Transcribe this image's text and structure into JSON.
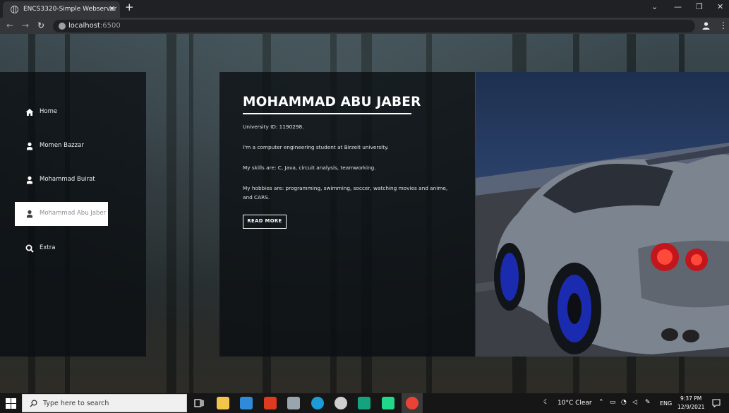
{
  "browser": {
    "tab_title": "ENCS3320-Simple Webserver",
    "tab_close": "✕",
    "new_tab": "+",
    "url_host": "localhost",
    "url_port": ":6500",
    "window_controls": {
      "minimize": "—",
      "maximize": "❐",
      "close": "✕",
      "tab_search": "⌄"
    },
    "nav": {
      "back": "←",
      "forward": "→",
      "reload": "↻"
    }
  },
  "sidebar": {
    "items": [
      {
        "label": "Home",
        "icon": "home-icon",
        "active": false
      },
      {
        "label": "Momen Bazzar",
        "icon": "user-icon",
        "active": false
      },
      {
        "label": "Mohammad Buirat",
        "icon": "user-icon",
        "active": false
      },
      {
        "label": "Mohammad Abu Jaber",
        "icon": "user-icon",
        "active": true
      },
      {
        "label": "Extra",
        "icon": "search-icon",
        "active": false
      }
    ]
  },
  "profile": {
    "name": "MOHAMMAD ABU JABER",
    "university_id": "University ID: 1190298.",
    "about": "I'm a computer engineering student at Birzeit university.",
    "skills": "My skills are: C, Java, circuit analysis, teamworking.",
    "hobbies": "My hobbies are: programming, swimming, soccer, watching movies and anime, and CARS.",
    "read_more": "READ MORE"
  },
  "taskbar": {
    "search_placeholder": "Type here to search",
    "weather": "10°C  Clear",
    "language": "ENG",
    "time": "9:37 PM",
    "date": "12/9/2021"
  },
  "colors": {
    "panel_bg": "#0a0e12",
    "active_item_bg": "#ffffff",
    "text_primary": "#ffffff",
    "chrome_dark": "#202124",
    "chrome_toolbar": "#35363a"
  }
}
